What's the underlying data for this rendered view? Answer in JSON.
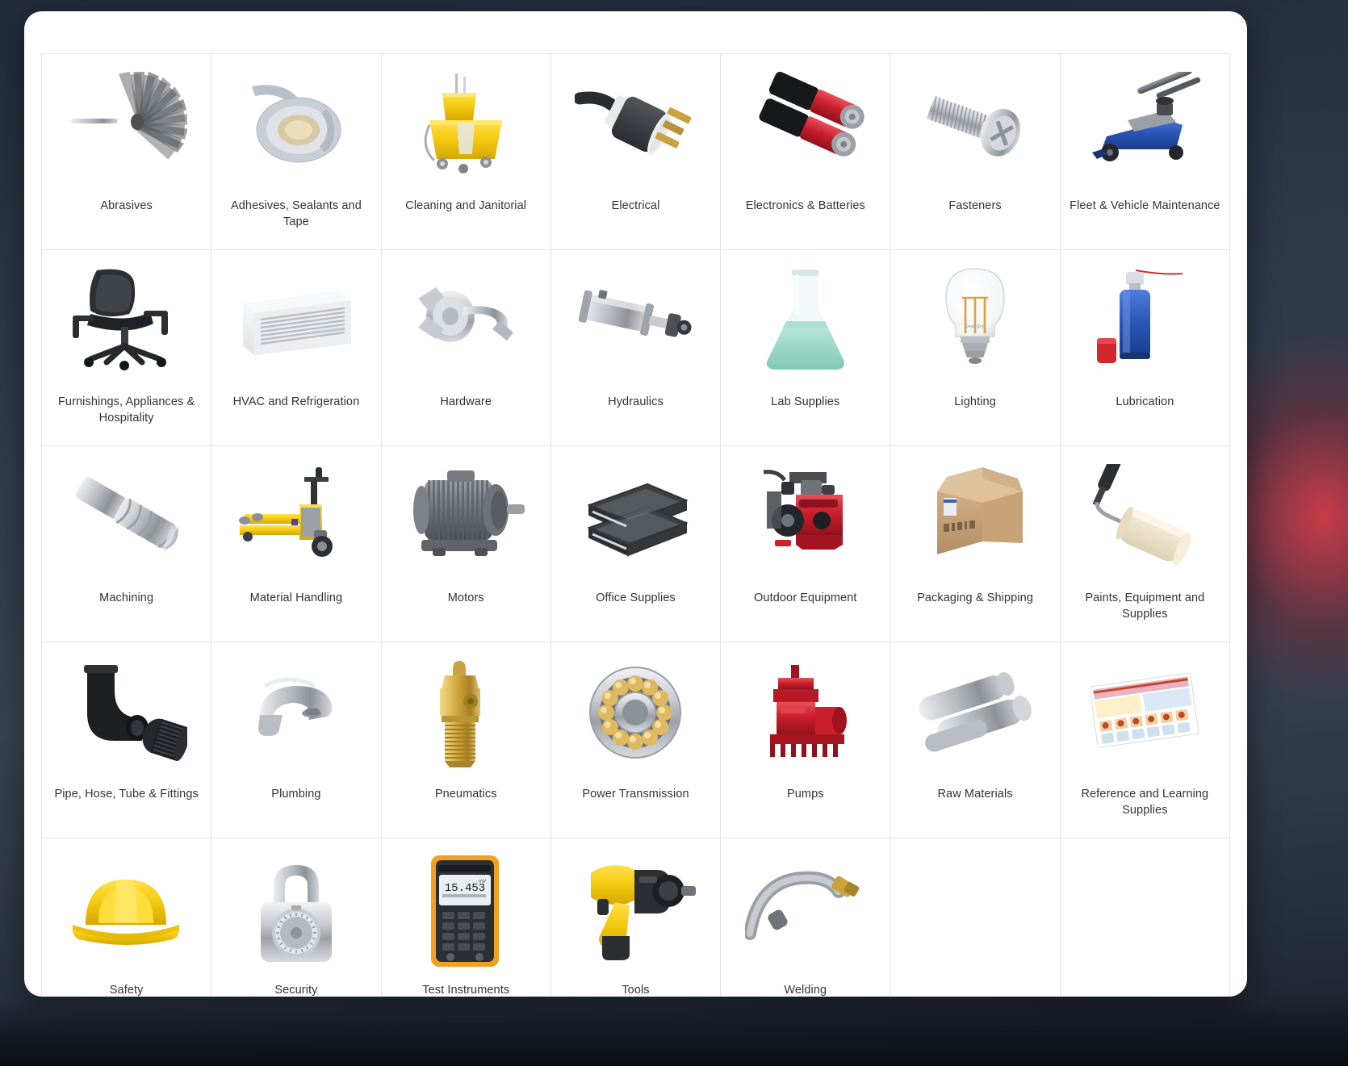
{
  "page": {
    "background_color": "#2c3544",
    "accent_glow_color": "#e23a48",
    "card_background": "#ffffff",
    "grid_border_color": "#e3e3e3",
    "caption_color": "#333333",
    "columns": 7
  },
  "categories": [
    {
      "label": "Abrasives",
      "icon": "abrasive-flap-wheel-icon"
    },
    {
      "label": "Adhesives, Sealants and Tape",
      "icon": "tape-roll-icon"
    },
    {
      "label": "Cleaning and Janitorial",
      "icon": "mop-bucket-icon"
    },
    {
      "label": "Electrical",
      "icon": "power-plug-icon"
    },
    {
      "label": "Electronics & Batteries",
      "icon": "batteries-icon"
    },
    {
      "label": "Fasteners",
      "icon": "screw-bolt-icon"
    },
    {
      "label": "Fleet & Vehicle Maintenance",
      "icon": "floor-jack-icon"
    },
    {
      "label": "Furnishings, Appliances & Hospitality",
      "icon": "office-chair-icon"
    },
    {
      "label": "HVAC and Refrigeration",
      "icon": "air-conditioner-icon"
    },
    {
      "label": "Hardware",
      "icon": "door-lever-lock-icon"
    },
    {
      "label": "Hydraulics",
      "icon": "hydraulic-cylinder-icon"
    },
    {
      "label": "Lab Supplies",
      "icon": "erlenmeyer-flask-icon"
    },
    {
      "label": "Lighting",
      "icon": "light-bulb-icon"
    },
    {
      "label": "Lubrication",
      "icon": "spray-can-icon"
    },
    {
      "label": "Machining",
      "icon": "end-mill-cutter-icon"
    },
    {
      "label": "Material Handling",
      "icon": "pallet-jack-icon"
    },
    {
      "label": "Motors",
      "icon": "electric-motor-icon"
    },
    {
      "label": "Office Supplies",
      "icon": "paper-tray-icon"
    },
    {
      "label": "Outdoor Equipment",
      "icon": "snow-blower-icon"
    },
    {
      "label": "Packaging & Shipping",
      "icon": "cardboard-box-icon"
    },
    {
      "label": "Paints, Equipment and Supplies",
      "icon": "paint-roller-icon"
    },
    {
      "label": "Pipe, Hose, Tube & Fittings",
      "icon": "pipe-elbow-fitting-icon"
    },
    {
      "label": "Plumbing",
      "icon": "faucet-icon"
    },
    {
      "label": "Pneumatics",
      "icon": "brass-valve-icon"
    },
    {
      "label": "Power Transmission",
      "icon": "ball-bearing-icon"
    },
    {
      "label": "Pumps",
      "icon": "sump-pump-icon"
    },
    {
      "label": "Raw Materials",
      "icon": "metal-bars-icon"
    },
    {
      "label": "Reference and Learning Supplies",
      "icon": "safety-poster-icon"
    },
    {
      "label": "Safety",
      "icon": "hard-hat-icon"
    },
    {
      "label": "Security",
      "icon": "combination-padlock-icon"
    },
    {
      "label": "Test Instruments",
      "icon": "multimeter-icon"
    },
    {
      "label": "Tools",
      "icon": "cordless-drill-icon"
    },
    {
      "label": "Welding",
      "icon": "welding-torch-icon"
    },
    {
      "label": "",
      "icon": ""
    },
    {
      "label": "",
      "icon": ""
    }
  ],
  "multimeter_display_value": "15.453"
}
